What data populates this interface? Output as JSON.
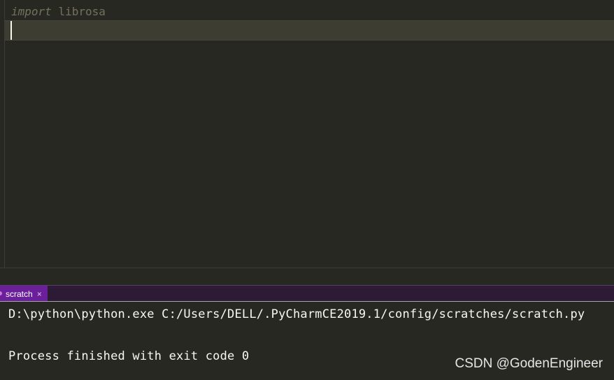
{
  "editor": {
    "code_keyword": "import",
    "code_module": " librosa"
  },
  "run_tab": {
    "label": "scratch",
    "close_glyph": "×"
  },
  "console": {
    "command": "D:\\python\\python.exe C:/Users/DELL/.PyCharmCE2019.1/config/scratches/scratch.py",
    "blank": "",
    "exit_message": "Process finished with exit code 0"
  },
  "watermark": "CSDN @GodenEngineer",
  "colors": {
    "editor_bg": "#272822",
    "comment_gray": "#75715e",
    "tab_purple": "#6b1f9a",
    "console_text": "#f8f8f2"
  }
}
